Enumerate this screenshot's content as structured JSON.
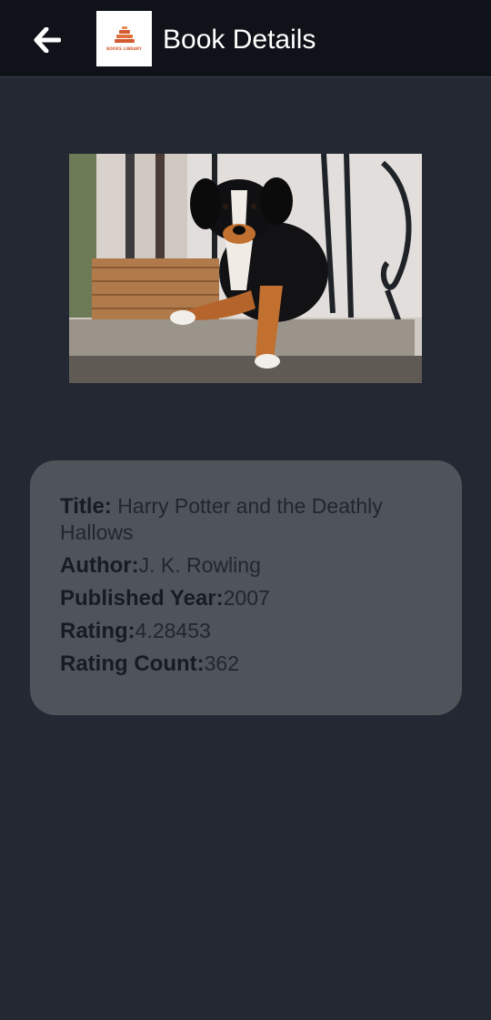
{
  "app_bar": {
    "title": "Book Details",
    "logo_text": "BOOKS LIBRARY",
    "back_icon": "arrow-left-icon"
  },
  "book": {
    "title_label": "Title:",
    "title_value": " Harry Potter and the Deathly Hallows",
    "author_label": "Author:",
    "author_value": "J. K. Rowling",
    "year_label": "Published Year:",
    "year_value": "2007",
    "rating_label": "Rating:",
    "rating_value": "4.28453",
    "rating_count_label": "Rating Count:",
    "rating_count_value": "362"
  },
  "colors": {
    "background": "#242832",
    "app_bar": "#0f1218",
    "card": "#4f545b",
    "logo_accent": "#d25a30"
  }
}
